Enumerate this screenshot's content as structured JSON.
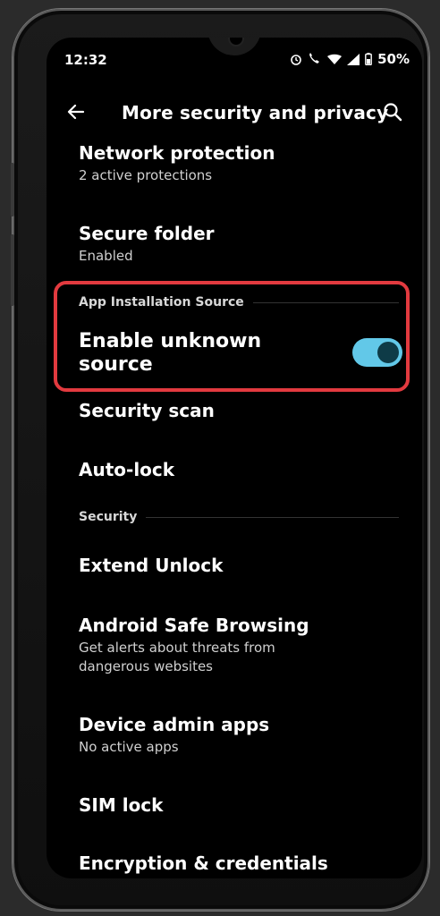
{
  "status_bar": {
    "time": "12:32",
    "battery": "50%"
  },
  "app_bar": {
    "title": "More security and privacy"
  },
  "items": {
    "network": {
      "title": "Network protection",
      "subtitle": "2 active protections"
    },
    "secure_folder": {
      "title": "Secure folder",
      "subtitle": "Enabled"
    },
    "app_install_section": "App Installation Source",
    "unknown_source": {
      "title": "Enable unknown source",
      "toggle_on": true
    },
    "security_scan": {
      "title": "Security scan"
    },
    "auto_lock": {
      "title": "Auto-lock"
    },
    "security_section": "Security",
    "extend_unlock": {
      "title": "Extend Unlock"
    },
    "safe_browsing": {
      "title": "Android Safe Browsing",
      "subtitle": "Get alerts about threats from dangerous websites"
    },
    "device_admin": {
      "title": "Device admin apps",
      "subtitle": "No active apps"
    },
    "sim_lock": {
      "title": "SIM lock"
    },
    "encryption": {
      "title": "Encryption & credentials"
    }
  },
  "colors": {
    "highlight": "#e23a3f",
    "toggle_track": "#62c8e8",
    "toggle_knob": "#0e3b47"
  },
  "icons": [
    "back-arrow-icon",
    "search-icon",
    "alarm-icon",
    "wifi-call-icon",
    "wifi-icon",
    "signal-icon",
    "battery-icon"
  ]
}
